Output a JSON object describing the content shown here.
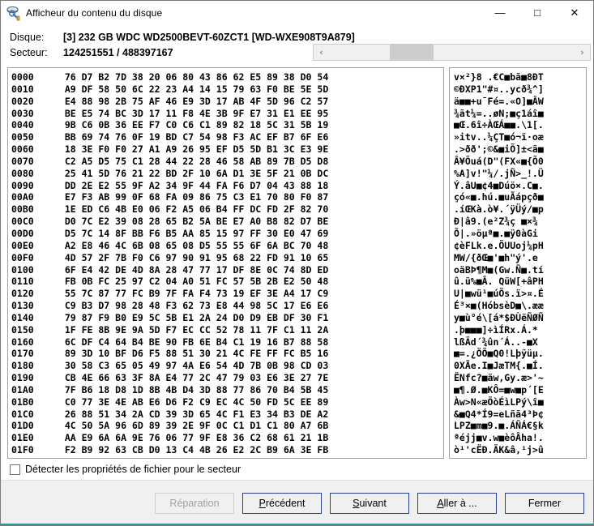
{
  "window": {
    "title": "Afficheur du contenu du disque",
    "icon": "disk-magnifier-icon",
    "minimize": "—",
    "maximize": "□",
    "close": "✕",
    "accent_color": "#2e95a3",
    "button_border_color": "#2a3f8f"
  },
  "info": {
    "disk_label": "Disque:",
    "disk_value": "[3] 232 GB  WDC WD2500BEVT-60ZCT1 [WD-WXE908T9A879]",
    "sector_label": "Secteur:",
    "sector_value": "124251551 / 488397167"
  },
  "scrollbar": {
    "left_arrow": "‹",
    "right_arrow": "›",
    "thumb_position_pct": 30
  },
  "hex_view": {
    "offsets": [
      "0000",
      "0010",
      "0020",
      "0030",
      "0040",
      "0050",
      "0060",
      "0070",
      "0080",
      "0090",
      "00A0",
      "00B0",
      "00C0",
      "00D0",
      "00E0",
      "00F0",
      "0100",
      "0110",
      "0120",
      "0130",
      "0140",
      "0150",
      "0160",
      "0170",
      "0180",
      "0190",
      "01A0",
      "01B0",
      "01C0",
      "01D0",
      "01E0",
      "01F0"
    ],
    "rows": [
      "76 D7 B2 7D 38 20 06 80 43 86 62 E5 89 38 D0 54",
      "A9 DF 58 50 6C 22 23 A4 14 15 79 63 F0 BE 5E 5D",
      "E4 88 98 2B 75 AF 46 E9 3D 17 AB 4F 5D 96 C2 57",
      "BE E5 74 BC 3D 17 11 F8 4E 3B 9F E7 31 E1 EE 95",
      "9B C6 0B 36 EE F7 C0 C6 C1 89 82 18 5C 31 5B 19",
      "BB 69 74 76 0F 19 BD C7 54 98 F3 AC EF B7 6F E6",
      "18 3E F0 F0 27 A1 A9 26 95 EF D5 5D B1 3C E3 9E",
      "C2 A5 D5 75 C1 28 44 22 28 46 58 AB 89 7B D5 D8",
      "25 41 5D 76 21 22 BD 2F 10 6A D1 3E 5F 21 0B DC",
      "DD 2E E2 55 9F A2 34 9F 44 FA F6 D7 04 43 88 18",
      "E7 F3 AB 99 0F 68 FA 09 86 75 C3 E1 70 80 F0 87",
      "1E ED C6 4B E0 06 F2 A5 06 B4 FF DC FD 2F 82 70",
      "D0 7C E2 39 08 28 65 B2 5A BE E7 A0 B8 82 D7 BE",
      "D5 7C 14 8F BB F6 B5 AA 85 15 97 FF 30 E0 47 69",
      "A2 E8 46 4C 6B 08 65 08 D5 55 55 6F 6A BC 70 48",
      "4D 57 2F 7B F0 C6 97 90 91 95 68 22 FD 91 10 65",
      "6F E4 42 DE 4D 8A 28 47 77 17 DF 8E 0C 74 8D ED",
      "FB 0B FC 25 97 C2 04 A0 51 FC 57 5B 2B E2 50 48",
      "55 7C 87 77 FC B9 7F FA F4 73 19 EF 3E A4 17 C9",
      "C9 B3 D7 98 28 48 F3 62 73 E8 44 98 5C 17 E6 E6",
      "79 87 F9 B0 E9 5C 5B E1 2A 24 D0 D9 EB DF 30 F1",
      "1F FE 8B 9E 9A 5D F7 EC CC 52 78 11 7F C1 11 2A",
      "6C DF C4 64 B4 BE 90 FB 6E B4 C1 19 16 B7 88 58",
      "89 3D 10 BF D6 F5 88 51 30 21 4C FE FF FC B5 16",
      "30 58 C3 65 05 49 97 4A E6 54 4D 7B 0B 98 CD 03",
      "CB 4E 66 63 3F 8A E4 77 2C 47 79 03 E6 3E 27 7E",
      "7F B6 18 D8 1D 8B 4B D4 3D 88 77 86 70 B4 5B 45",
      "C0 77 3E 4E AB E6 D6 F2 C9 EC 4C 50 FD 5C EE 89",
      "26 88 51 34 2A CD 39 3D 65 4C F1 E3 34 B3 DE A2",
      "4C 50 5A 96 6D 89 39 2E 9F 0C C1 D1 C1 80 A7 6B",
      "AA E9 6A 6A 9E 76 06 77 9F E8 36 C2 68 61 21 1B",
      "F2 B9 92 63 CB D0 13 C4 4B 26 E2 2C B9 6A 3E FB"
    ]
  },
  "ascii_view": {
    "lines": [
      "v×²}8 .€C■bã■8ÐT",
      "©ÐXP1\"#¤..ycð¾^]",
      "ä■■+u¯Fé=.«O]■ÂW",
      "¾ãt¼=..øN;■ç1áî■",
      "■Œ.6î÷ÀŒÁ■■.\\1[.",
      "»itv..¼ÇT■ó¬ï·oæ",
      ".>ðð';©&■iÕ]±<ã■",
      "Â¥Õuá(D\"(FX«■{Õ0",
      "%A]v!\"¼/.jÑ>_!.Ü",
      "Ý.âU■¢4■Dúö×.C■.",
      "çó«■.hú.■uÃápçð■",
      ".íŒKà.ò¥.´ÿÜý/■p",
      "Ð|â9.(e²Z¾ç ■×¾",
      "Õ|.»öµª■.■ÿ0àGi",
      "¢èFLk.e.ÕUUoj¼pH",
      "MW/{ðŒ■'■h\"ý'.e",
      "oäBÞ¶M■(Gw.Ñ■.tí",
      "û.ü%■Â. QüW[+âPH",
      "U|■wü¹■úÕs.ï>¤.É",
      "É³×■(HóbsèD■\\.ææ",
      "y■ù°é\\[á*$ÐÙëÑØÑ",
      ".þ■■■]÷ìÍRx.Á.*",
      "lßÄd´¾ûn´Á..-■X",
      "■=.¿ÖÕ■Q0!Lþÿüµ.",
      "0XÃe.I■JæTM{.■Í.",
      "ËNfc?■äw,Gy.æ>'~",
      "■¶.Ø.■KÔ=■w■p´[E",
      "Àw>N«æÖòÉìLPý\\î■",
      "&■Q4*Í9=eLñã4³Þ¢",
      "LPZ■m■9.■.ÁÑÁ€§k",
      "ªéjj■v.w■èôÂha!.",
      "ò¹'cËÐ.ÄK&â,¹j>û"
    ]
  },
  "checkbox": {
    "label": "Détecter les propriétés de fichier pour le secteur",
    "checked": false
  },
  "buttons": [
    {
      "name": "repair",
      "label": "Réparation",
      "mnemonic": "",
      "disabled": true
    },
    {
      "name": "previous",
      "label": "Précédent",
      "mnemonic": "P",
      "disabled": false
    },
    {
      "name": "next",
      "label": "Suivant",
      "mnemonic": "S",
      "disabled": false
    },
    {
      "name": "goto",
      "label": "Aller à ...",
      "mnemonic": "A",
      "disabled": false
    },
    {
      "name": "close",
      "label": "Fermer",
      "mnemonic": "",
      "disabled": false
    }
  ]
}
